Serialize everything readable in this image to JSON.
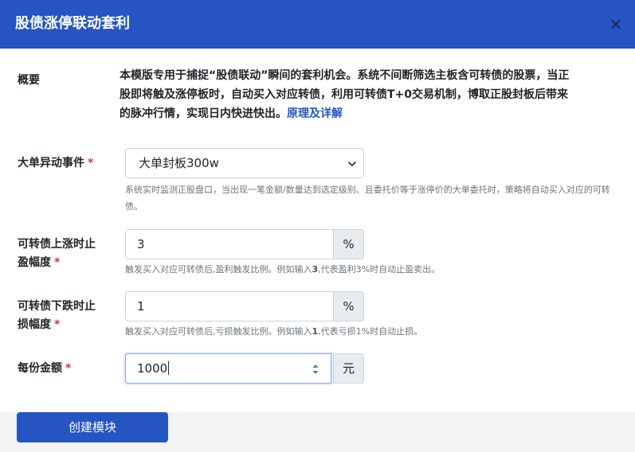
{
  "modal": {
    "title": "股债涨停联动套利",
    "close_glyph": "×"
  },
  "summary": {
    "label": "概要",
    "text": "本模版专用于捕捉“股债联动”瞬间的套利机会。系统不间断筛选主板含可转债的股票，当正股即将触及涨停板时，自动买入对应转债，利用可转债T+0交易机制，博取正股封板后带来的脉冲行情，实现日内快进快出。",
    "link": "原理及详解"
  },
  "event": {
    "label": "大单异动事件",
    "required_mark": "*",
    "selected": "大单封板300w",
    "help": "系统实时监测正股盘口，当出现一笔金额/数量达到选定级别、且委托价等于涨停价的大单委托时，策略将自动买入对应的可转债。"
  },
  "take_profit": {
    "label_line1": "可转债上涨时止",
    "label_line2": "盈幅度",
    "required_mark": "*",
    "value": "3",
    "unit": "%",
    "help_prefix": "触发买入对应可转债后,盈利触发比例。例如输入",
    "help_example": "3",
    "help_suffix": ",代表盈利3%时自动止盈卖出。"
  },
  "stop_loss": {
    "label_line1": "可转债下跌时止",
    "label_line2": "损幅度",
    "required_mark": "*",
    "value": "1",
    "unit": "%",
    "help_prefix": "触发买入对应可转债后,亏损触发比例。例如输入",
    "help_example": "1",
    "help_suffix": ",代表亏损1%时自动止损。"
  },
  "amount": {
    "label": "每份金额",
    "required_mark": "*",
    "value": "1000",
    "unit": "元"
  },
  "footer": {
    "create_label": "创建模块"
  },
  "icons": {
    "close": "close-icon",
    "select": "chevron-down-icon",
    "spinner": "spinner-arrows-icon"
  },
  "colors": {
    "header": "#2455c3",
    "primary_button": "#2455c3",
    "required": "#d63344",
    "link": "#2455c3"
  }
}
